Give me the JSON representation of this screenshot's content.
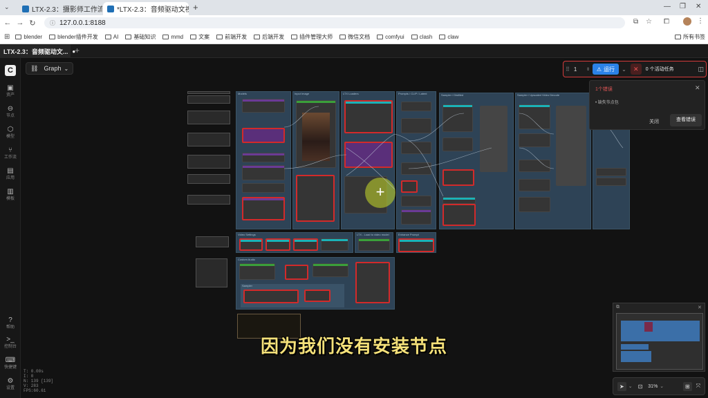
{
  "browser": {
    "tabs": [
      {
        "title": "LTX-2.3：摄影师工作流、文生"
      },
      {
        "title": "*LTX-2.3：音频驱动文视频生"
      }
    ],
    "url": "127.0.0.1:8188",
    "bookmarks": [
      "blender",
      "blender插件开发",
      "AI",
      "基础知识",
      "mmd",
      "文案",
      "前端开发",
      "后端开发",
      "插件管理大师",
      "微信文档",
      "comfyui",
      "clash",
      "claw"
    ],
    "all_bookmarks": "所有书签"
  },
  "app": {
    "tab_title": "LTX-2.3：音频驱动文...",
    "add_tab": "+"
  },
  "sidebar": {
    "items": [
      {
        "label": "资产",
        "icon": "image-icon"
      },
      {
        "label": "节点",
        "icon": "node-icon"
      },
      {
        "label": "模型",
        "icon": "cube-icon"
      },
      {
        "label": "工作流",
        "icon": "workflow-icon"
      },
      {
        "label": "应用",
        "icon": "app-icon"
      },
      {
        "label": "模板",
        "icon": "template-icon"
      }
    ],
    "bottom": [
      {
        "label": "帮助",
        "icon": "help-icon"
      },
      {
        "label": "控制台",
        "icon": "terminal-icon"
      },
      {
        "label": "快捷键",
        "icon": "keyboard-icon"
      },
      {
        "label": "设置",
        "icon": "gear-icon"
      }
    ]
  },
  "canvas": {
    "mode_label": "Graph",
    "groups": [
      "Models",
      "Input Image",
      "LTX Loaders",
      "Prompts / CLIP / Latent",
      "Sampler / Distilled",
      "Sampler / Upscaled Video Decode",
      "Video Settings",
      "LTX - Load to video model",
      "Enhance Prompt",
      "Custom Audio",
      "Sampler"
    ]
  },
  "runbar": {
    "count": "1",
    "run_label": "运行",
    "active_tasks": "0 个活动任务"
  },
  "error_panel": {
    "title": "1个错误",
    "item": "缺失节点包",
    "close_label": "关闭",
    "view_label": "查看错误"
  },
  "map_tools": {
    "zoom": "31%"
  },
  "subtitle": "因为我们没有安装节点",
  "stats": [
    "T: 0.00s",
    "I: 0",
    "N: 139 [139]",
    "V: 283",
    "FPS:60.61"
  ]
}
